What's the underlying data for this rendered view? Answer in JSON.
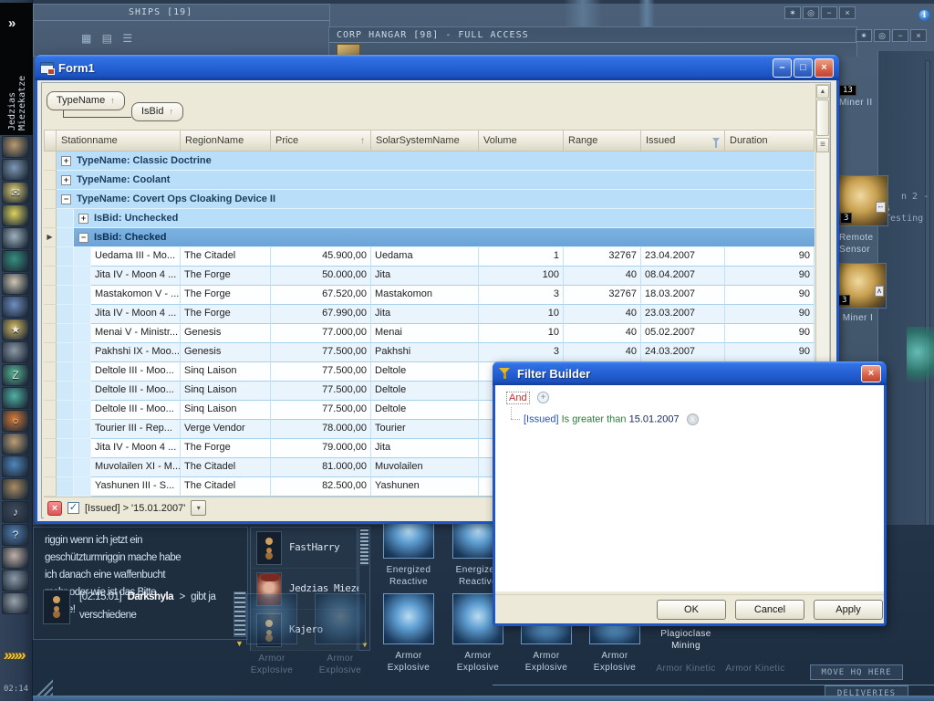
{
  "colors": {
    "luna_blue": "#2763d6",
    "group_blue": "#b9def9",
    "selected_blue": "#6aa4d8",
    "eve_bg": "#3a4d63",
    "client_beige": "#ece9d8"
  },
  "eve": {
    "neocom": {
      "expander": "»",
      "char_name": "Jedzias Miezekatze",
      "arrows": "»»»",
      "clock": "02:14",
      "icons": [
        {
          "name": "char-sheet",
          "color": "#b99a6f",
          "glyph": ""
        },
        {
          "name": "map-browser",
          "color": "#7e98b4",
          "glyph": ""
        },
        {
          "name": "mail",
          "color": "#e3cf6e",
          "glyph": "✉"
        },
        {
          "name": "notepad",
          "color": "#ded45e",
          "glyph": ""
        },
        {
          "name": "market",
          "color": "#9fb0bd",
          "glyph": ""
        },
        {
          "name": "wallet",
          "color": "#35907f",
          "glyph": ""
        },
        {
          "name": "contracts",
          "color": "#cfc6b2",
          "glyph": ""
        },
        {
          "name": "fleet",
          "color": "#6f8ec2",
          "glyph": ""
        },
        {
          "name": "standings",
          "color": "#d9bd62",
          "glyph": "★"
        },
        {
          "name": "assets",
          "color": "#8d9aa6",
          "glyph": ""
        },
        {
          "name": "corp-logo",
          "color": "#57b893",
          "glyph": "Z"
        },
        {
          "name": "calculator",
          "color": "#4fb2a2",
          "glyph": ""
        },
        {
          "name": "help",
          "color": "#d97a33",
          "glyph": "○"
        },
        {
          "name": "channels",
          "color": "#bd9f74",
          "glyph": ""
        },
        {
          "name": "world-browser",
          "color": "#4f86bd",
          "glyph": ""
        },
        {
          "name": "journal",
          "color": "#a98c62",
          "glyph": ""
        },
        {
          "name": "jukebox",
          "color": "#3e4a59",
          "glyph": "♪"
        },
        {
          "name": "tutorial",
          "color": "#4f7eb4",
          "glyph": "?"
        },
        {
          "name": "portrait",
          "color": "#c2b0a6",
          "glyph": ""
        },
        {
          "name": "ships",
          "color": "#8c9aa8",
          "glyph": ""
        },
        {
          "name": "items",
          "color": "#9aa3ac",
          "glyph": ""
        }
      ]
    },
    "ships_window_title": "SHIPS [19]",
    "corp_hangar_title": "CORP HANGAR [98] - FULL ACCESS",
    "window_control_glyphs": [
      "✶",
      "◎",
      "−",
      "×"
    ],
    "view_mode_glyphs": "▦ ▤ ☰",
    "chat": {
      "lines": [
        "riggin wenn ich jetzt ein",
        "geschützturmriggin mache habe",
        "ich danach eine waffenbucht",
        "mehr oder wie ist das Bitte",
        "Danke!"
      ],
      "entry": {
        "time": "[02:15:01]",
        "author": "Darkshyla",
        "sep": ">",
        "text": "gibt ja verschiedene"
      }
    },
    "members": [
      "FastHarry",
      "Jedzias Miezek",
      "Kajero"
    ],
    "right_items": {
      "miner2_qty": "13",
      "miner2_label": "Miner II",
      "remote_qty": "3",
      "remote_label": "Remote Sensor",
      "strip_qty": "3",
      "strip_label": "ip Miner I",
      "frag1": "n 2 -",
      "frag2": "s Testing"
    },
    "hangar": {
      "visible_items": [
        "Energized Reactive",
        "Energized Reactive",
        "Armor Explosive",
        "Armor Explosive",
        "Armor Explosive",
        "Armor Explosive"
      ],
      "dim_items": [
        "Armor Explosive",
        "Armor Explosive",
        "Armor Kinetic",
        "Armor Kinetic"
      ],
      "plagioclase": "Plagioclase Mining"
    },
    "buttons": {
      "move_hq": "MOVE HQ HERE",
      "deliveries": "DELIVERIES"
    }
  },
  "form": {
    "title": "Form1",
    "group_by": [
      {
        "label": "TypeName",
        "dir": "↑"
      },
      {
        "label": "IsBid",
        "dir": "↑"
      }
    ],
    "columns": [
      {
        "label": "Stationname"
      },
      {
        "label": "RegionName"
      },
      {
        "label": "Price",
        "sort": "↑"
      },
      {
        "label": "SolarSystemName"
      },
      {
        "label": "Volume"
      },
      {
        "label": "Range"
      },
      {
        "label": "Issued",
        "filtered": true
      },
      {
        "label": "Duration"
      }
    ],
    "grid_rows": [
      {
        "type": "group",
        "level": 0,
        "expanded": false,
        "label": "TypeName: Classic Doctrine"
      },
      {
        "type": "group",
        "level": 0,
        "expanded": false,
        "label": "TypeName: Coolant"
      },
      {
        "type": "group",
        "level": 0,
        "expanded": true,
        "label": "TypeName: Covert Ops Cloaking Device II"
      },
      {
        "type": "group",
        "level": 1,
        "expanded": false,
        "label": "IsBid: Unchecked"
      },
      {
        "type": "group",
        "level": 1,
        "expanded": true,
        "selected": true,
        "label": "IsBid: Checked"
      },
      {
        "type": "data",
        "cells": [
          "Uedama III - Mo...",
          "The Citadel",
          "45.900,00",
          "Uedama",
          "1",
          "32767",
          "23.04.2007",
          "90"
        ]
      },
      {
        "type": "data",
        "cells": [
          "Jita IV - Moon 4 ...",
          "The Forge",
          "50.000,00",
          "Jita",
          "100",
          "40",
          "08.04.2007",
          "90"
        ]
      },
      {
        "type": "data",
        "cells": [
          "Mastakomon V - ...",
          "The Forge",
          "67.520,00",
          "Mastakomon",
          "3",
          "32767",
          "18.03.2007",
          "90"
        ]
      },
      {
        "type": "data",
        "cells": [
          "Jita IV - Moon 4 ...",
          "The Forge",
          "67.990,00",
          "Jita",
          "10",
          "40",
          "23.03.2007",
          "90"
        ]
      },
      {
        "type": "data",
        "cells": [
          "Menai V - Ministr...",
          "Genesis",
          "77.000,00",
          "Menai",
          "10",
          "40",
          "05.02.2007",
          "90"
        ]
      },
      {
        "type": "data",
        "cells": [
          "Pakhshi IX - Moo...",
          "Genesis",
          "77.500,00",
          "Pakhshi",
          "3",
          "40",
          "24.03.2007",
          "90"
        ]
      },
      {
        "type": "data",
        "cells": [
          "Deltole III - Moo...",
          "Sinq Laison",
          "77.500,00",
          "Deltole",
          "",
          "",
          "",
          ""
        ]
      },
      {
        "type": "data",
        "cells": [
          "Deltole III - Moo...",
          "Sinq Laison",
          "77.500,00",
          "Deltole",
          "",
          "",
          "",
          ""
        ]
      },
      {
        "type": "data",
        "cells": [
          "Deltole III - Moo...",
          "Sinq Laison",
          "77.500,00",
          "Deltole",
          "",
          "",
          "",
          ""
        ]
      },
      {
        "type": "data",
        "cells": [
          "Tourier III - Rep...",
          "Verge Vendor",
          "78.000,00",
          "Tourier",
          "",
          "",
          "",
          ""
        ]
      },
      {
        "type": "data",
        "cells": [
          "Jita IV - Moon 4 ...",
          "The Forge",
          "79.000,00",
          "Jita",
          "",
          "",
          "",
          ""
        ]
      },
      {
        "type": "data",
        "cells": [
          "Muvolailen XI - M...",
          "The Citadel",
          "81.000,00",
          "Muvolailen",
          "",
          "",
          "",
          ""
        ]
      },
      {
        "type": "data",
        "cells": [
          "Yashunen III - S...",
          "The Citadel",
          "82.500,00",
          "Yashunen",
          "",
          "",
          "",
          ""
        ]
      }
    ],
    "filter_bar": {
      "checked": "✓",
      "text": "[Issued] > '15.01.2007'"
    }
  },
  "dialog": {
    "title": "Filter Builder",
    "root_op": "And",
    "add_glyph": "+",
    "remove_glyph": "x",
    "condition": {
      "field": "[Issued]",
      "operator": "Is greater than",
      "value": "15.01.2007"
    },
    "ok": "OK",
    "cancel": "Cancel",
    "apply": "Apply"
  }
}
